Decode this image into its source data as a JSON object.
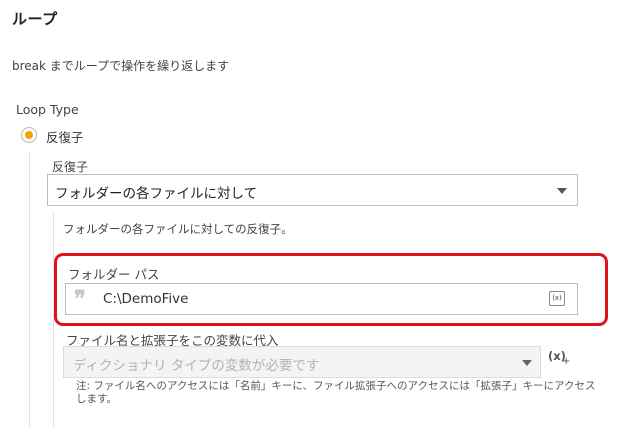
{
  "panel": {
    "title": "ループ",
    "description": "break までループで操作を繰り返します"
  },
  "loop_type": {
    "label": "Loop Type",
    "selected_option": "反復子",
    "accent_color": "#f5a100"
  },
  "iterator": {
    "label": "反復子",
    "value": "フォルダーの各ファイルに対して",
    "help": "フォルダーの各ファイルに対しての反復子。"
  },
  "folder_path": {
    "label": "フォルダー パス",
    "quote_icon": "❞",
    "value": "C:\\DemoFive",
    "variable_icon": "(x)",
    "highlight_color": "#e0101d"
  },
  "variable": {
    "label": "ファイル名と拡張子をこの変数に代入",
    "placeholder": "ディクショナリ タイプの変数が必要です",
    "add_icon": "(x)",
    "add_plus": "+",
    "note": "注: ファイル名へのアクセスには「名前」キーに、ファイル拡張子へのアクセスには「拡張子」キーにアクセスします。"
  }
}
